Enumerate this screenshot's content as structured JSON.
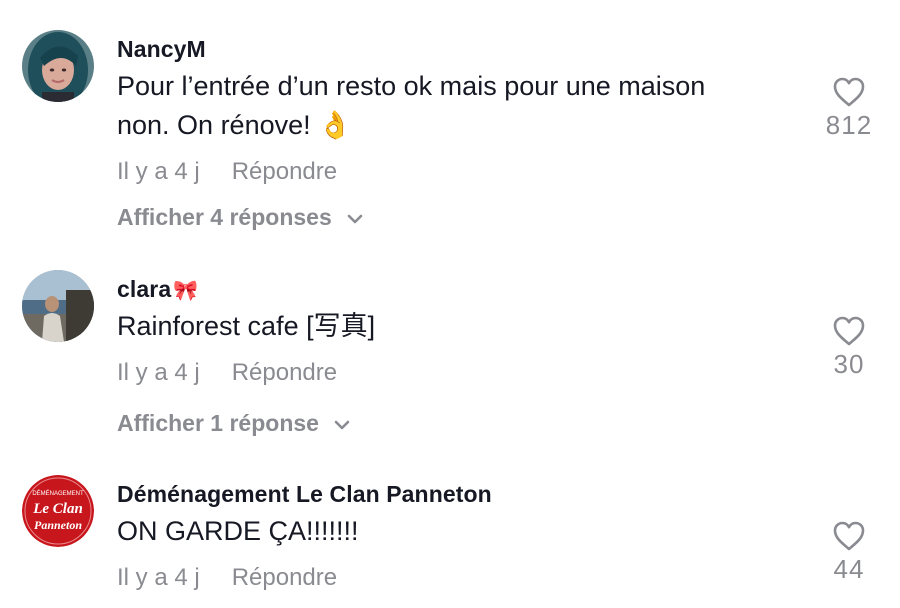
{
  "comments": [
    {
      "username": "NancyM",
      "username_emoji": "",
      "text_line1": "Pour l’entrée d’un resto ok mais pour une maison",
      "text_line2": "non. On rénove! 👌",
      "time": "Il y a 4 j",
      "reply_label": "Répondre",
      "view_replies": "Afficher 4 réponses",
      "likes": "812"
    },
    {
      "username": "clara",
      "username_emoji": "🎀",
      "text_line1": "Rainforest cafe [写真]",
      "time": "Il y a 4 j",
      "reply_label": "Répondre",
      "view_replies": "Afficher 1 réponse",
      "likes": "30"
    },
    {
      "username": "Déménagement Le Clan Panneton",
      "username_emoji": "",
      "text_line1": "ON GARDE ÇA!!!!!!!",
      "time": "Il y a 4 j",
      "reply_label": "Répondre",
      "likes": "44",
      "avatar_logo": {
        "top_text": "DÉMÉNAGEMENT",
        "line1": "Le Clan",
        "line2": "Panneton"
      }
    }
  ],
  "colors": {
    "text": "#161823",
    "muted": "#8a8b91",
    "logo_red": "#c8161d"
  },
  "icons": {
    "like": "heart-outline-icon",
    "expand": "chevron-down-icon"
  }
}
